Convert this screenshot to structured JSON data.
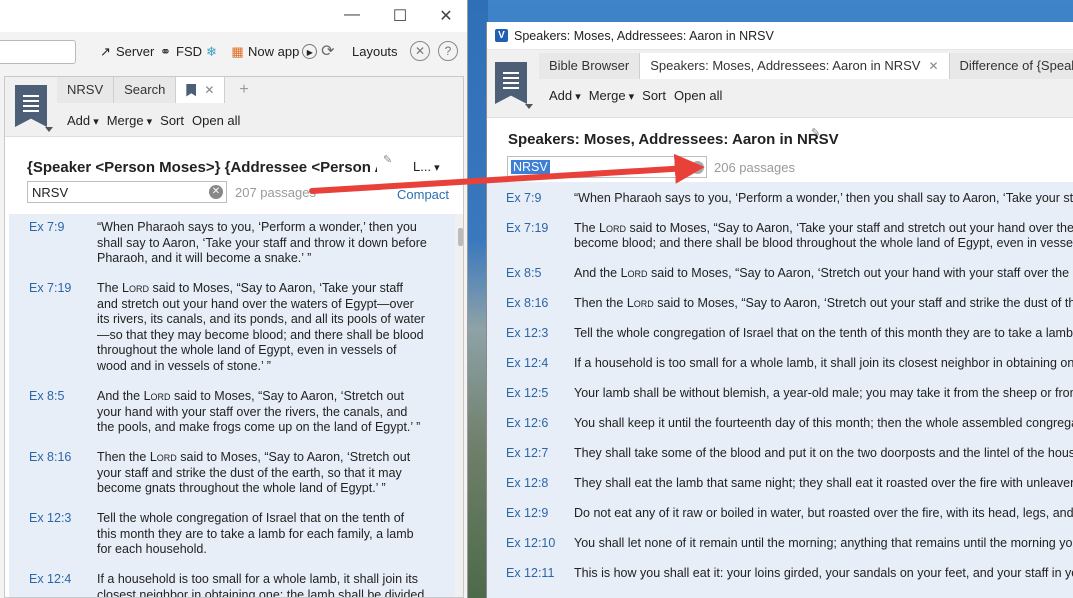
{
  "left_window": {
    "toolbar": {
      "server_label": "Server",
      "fsd_label": "FSD",
      "nowapp_label": "Now app",
      "layouts_label": "Layouts"
    },
    "tabs": [
      "NRSV",
      "Search"
    ],
    "commands": {
      "add": "Add",
      "merge": "Merge",
      "sort": "Sort",
      "open_all": "Open all"
    },
    "doc_title": "{Speaker <Person Moses>} {Addressee <Person Aaron>}",
    "layout_dropdown": "L...",
    "filter_value": "NRSV",
    "passage_count": "207 passages",
    "compact_label": "Compact",
    "results": [
      {
        "ref": "Ex 7:9",
        "text": "“When Pharaoh says to you, ‘Perform a wonder,’ then you shall say to Aaron, ‘Take your staff and throw it down before Pharaoh, and it will become a snake.’ ”"
      },
      {
        "ref": "Ex 7:19",
        "text": "The LORD said to Moses, “Say to Aaron, ‘Take your staff and stretch out your hand over the waters of Egypt—over its rivers, its canals, and its ponds, and all its pools of water—so that they may become blood; and there shall be blood throughout the whole land of Egypt, even in vessels of wood and in vessels of stone.’ ”"
      },
      {
        "ref": "Ex 8:5",
        "text": "And the LORD said to Moses, “Say to Aaron, ‘Stretch out your hand with your staff over the rivers, the canals, and the pools, and make frogs come up on the land of Egypt.’ ”"
      },
      {
        "ref": "Ex 8:16",
        "text": "Then the LORD said to Moses, “Say to Aaron, ‘Stretch out your staff and strike the dust of the earth, so that it may become gnats throughout the whole land of Egypt.’ ”"
      },
      {
        "ref": "Ex 12:3",
        "text": "Tell the whole congregation of Israel that on the tenth of this month they are to take a lamb for each family, a lamb for each household."
      },
      {
        "ref": "Ex 12:4",
        "text": "If a household is too small for a whole lamb, it shall join its closest neighbor in obtaining one; the lamb shall be divided"
      }
    ]
  },
  "right_window": {
    "window_title": "Speakers: Moses, Addressees: Aaron in NRSV",
    "tabs": [
      "Bible Browser",
      "Speakers: Moses, Addressees: Aaron in NRSV",
      "Difference of {Speaker <Pers"
    ],
    "commands": {
      "add": "Add",
      "merge": "Merge",
      "sort": "Sort",
      "open_all": "Open all"
    },
    "doc_title": "Speakers: Moses, Addressees: Aaron in NRSV",
    "filter_value": "NRSV",
    "passage_count": "206 passages",
    "results": [
      {
        "ref": "Ex 7:9",
        "text": "“When Pharaoh says to you, ‘Perform a wonder,’ then you shall say to Aaron, ‘Take your staff a"
      },
      {
        "ref": "Ex 7:19",
        "text": "The LORD said to Moses, “Say to Aaron, ‘Take your staff and stretch out your hand over the wa",
        "text2": "become blood; and there shall be blood throughout the whole land of Egypt, even in vessels o"
      },
      {
        "ref": "Ex 8:5",
        "text": "And the LORD said to Moses, “Say to Aaron, ‘Stretch out your hand with your staff over the rive"
      },
      {
        "ref": "Ex 8:16",
        "text": "Then the LORD said to Moses, “Say to Aaron, ‘Stretch out your staff and strike the dust of the e"
      },
      {
        "ref": "Ex 12:3",
        "text": "Tell the whole congregation of Israel that on the tenth of this month they are to take a lamb fo"
      },
      {
        "ref": "Ex 12:4",
        "text": "If a household is too small for a whole lamb, it shall join its closest neighbor in obtaining one;"
      },
      {
        "ref": "Ex 12:5",
        "text": "Your lamb shall be without blemish, a year-old male; you may take it from the sheep or from t"
      },
      {
        "ref": "Ex 12:6",
        "text": "You shall keep it until the fourteenth day of this month; then the whole assembled congregat"
      },
      {
        "ref": "Ex 12:7",
        "text": "They shall take some of the blood and put it on the two doorposts and the lintel of the houses"
      },
      {
        "ref": "Ex 12:8",
        "text": "They shall eat the lamb that same night; they shall eat it roasted over the fire with unleavene"
      },
      {
        "ref": "Ex 12:9",
        "text": "Do not eat any of it raw or boiled in water, but roasted over the fire, with its head, legs, and in"
      },
      {
        "ref": "Ex 12:10",
        "text": "You shall let none of it remain until the morning; anything that remains until the morning you"
      },
      {
        "ref": "Ex 12:11",
        "text": "This is how you shall eat it: your loins girded, your sandals on your feet, and your staff in your"
      }
    ]
  },
  "annotation_arrow_color": "#e8413a",
  "accent_color": "#2b66a8",
  "results_bg": "#e7eef8"
}
